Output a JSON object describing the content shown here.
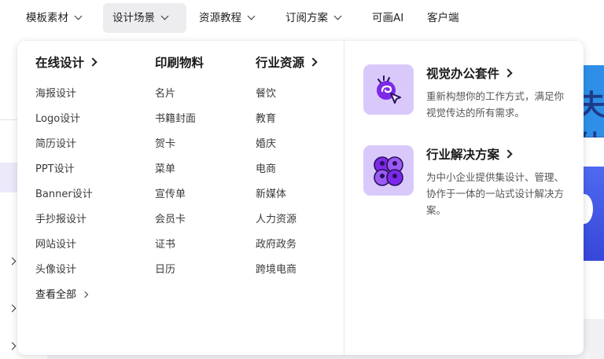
{
  "topnav": {
    "items": [
      {
        "label": "模板素材",
        "has_dropdown": true
      },
      {
        "label": "设计场景",
        "has_dropdown": true,
        "active": true
      },
      {
        "label": "资源教程",
        "has_dropdown": true
      },
      {
        "label": "订阅方案",
        "has_dropdown": true
      },
      {
        "label": "可画AI",
        "has_dropdown": false
      },
      {
        "label": "客户端",
        "has_dropdown": false
      }
    ]
  },
  "background": {
    "banner_text": "夫体"
  },
  "menu": {
    "columns": [
      {
        "title": "在线设计",
        "has_arrow": true,
        "items": [
          "海报设计",
          "Logo设计",
          "简历设计",
          "PPT设计",
          "Banner设计",
          "手抄报设计",
          "网站设计",
          "头像设计"
        ],
        "see_all": "查看全部"
      },
      {
        "title": "印刷物料",
        "has_arrow": false,
        "items": [
          "名片",
          "书籍封面",
          "贺卡",
          "菜单",
          "宣传单",
          "会员卡",
          "证书",
          "日历"
        ]
      },
      {
        "title": "行业资源",
        "has_arrow": true,
        "items": [
          "餐饮",
          "教育",
          "婚庆",
          "电商",
          "新媒体",
          "人力资源",
          "政府政务",
          "跨境电商"
        ]
      }
    ],
    "cards": [
      {
        "title": "视觉办公套件",
        "description": "重新构想你的工作方式，满足你视觉传达的所有需求。",
        "icon": "office-suite-icon"
      },
      {
        "title": "行业解决方案",
        "description": "为中小企业提供集设计、管理、协作于一体的一站式设计解决方案。",
        "icon": "industry-solutions-icon"
      }
    ]
  },
  "colors": {
    "accent_purple": "#7d2ae8",
    "icon_bg": "#d9c9fb",
    "active_nav_bg": "#ededf0"
  }
}
